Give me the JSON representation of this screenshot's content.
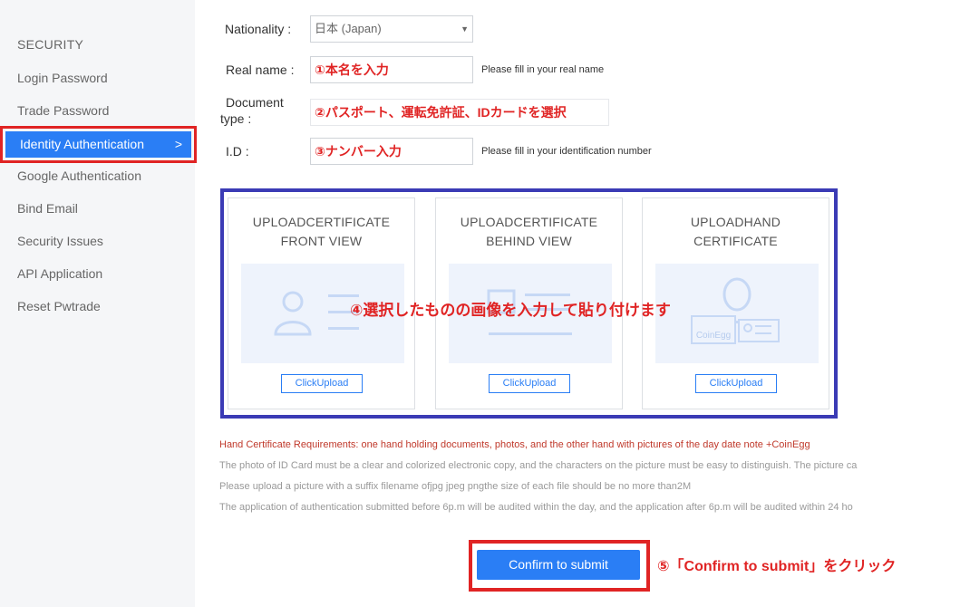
{
  "sidebar": {
    "heading": "SECURITY",
    "items": [
      {
        "label": "Login Password"
      },
      {
        "label": "Trade Password"
      },
      {
        "label": "Identity Authentication",
        "active": true
      },
      {
        "label": "Google Authentication"
      },
      {
        "label": "Bind Email"
      },
      {
        "label": "Security Issues"
      },
      {
        "label": "API Application"
      },
      {
        "label": "Reset Pwtrade"
      }
    ],
    "active_chevron": ">"
  },
  "form": {
    "nationality": {
      "label": "Nationality :",
      "value": "日本 (Japan)"
    },
    "real_name": {
      "label": "Real name :",
      "value": "①本名を入力",
      "hint": "Please fill in your real name"
    },
    "document_type": {
      "label_line1": "Document",
      "label_line2": "type :",
      "value": "②パスポート、運転免許証、IDカードを選択"
    },
    "id": {
      "label": "I.D :",
      "value": "③ナンバー入力",
      "hint": "Please fill in your identification number"
    }
  },
  "upload": {
    "cards": [
      {
        "title_line1": "UPLOADCERTIFICATE",
        "title_line2": "FRONT VIEW",
        "button": "ClickUpload"
      },
      {
        "title_line1": "UPLOADCERTIFICATE",
        "title_line2": "BEHIND VIEW",
        "button": "ClickUpload"
      },
      {
        "title_line1": "UPLOADHAND",
        "title_line2": "CERTIFICATE",
        "button": "ClickUpload",
        "badge": "CoinEgg"
      }
    ],
    "note": "④選択したものの画像を入力して貼り付けます"
  },
  "requirements": {
    "hand_certificate": "Hand Certificate Requirements: one hand holding documents, photos, and the other hand with pictures of the day date note +CoinEgg",
    "photo_rule": "The photo of ID Card must be a clear and colorized electronic copy, and the characters on the picture must be easy to distinguish. The picture ca",
    "file_rule": "Please upload a picture with a suffix filename ofjpg jpeg pngthe size of each file should be no more than2M",
    "audit_rule": "The application of authentication submitted before 6p.m will be audited within the day, and the application after 6p.m will be audited within 24 ho"
  },
  "submit": {
    "label": "Confirm to submit",
    "note": "⑤「Confirm to submit」をクリック"
  },
  "colors": {
    "accent": "#2a7ef5",
    "annotation": "#e02424",
    "frame": "#3b3bb5"
  }
}
